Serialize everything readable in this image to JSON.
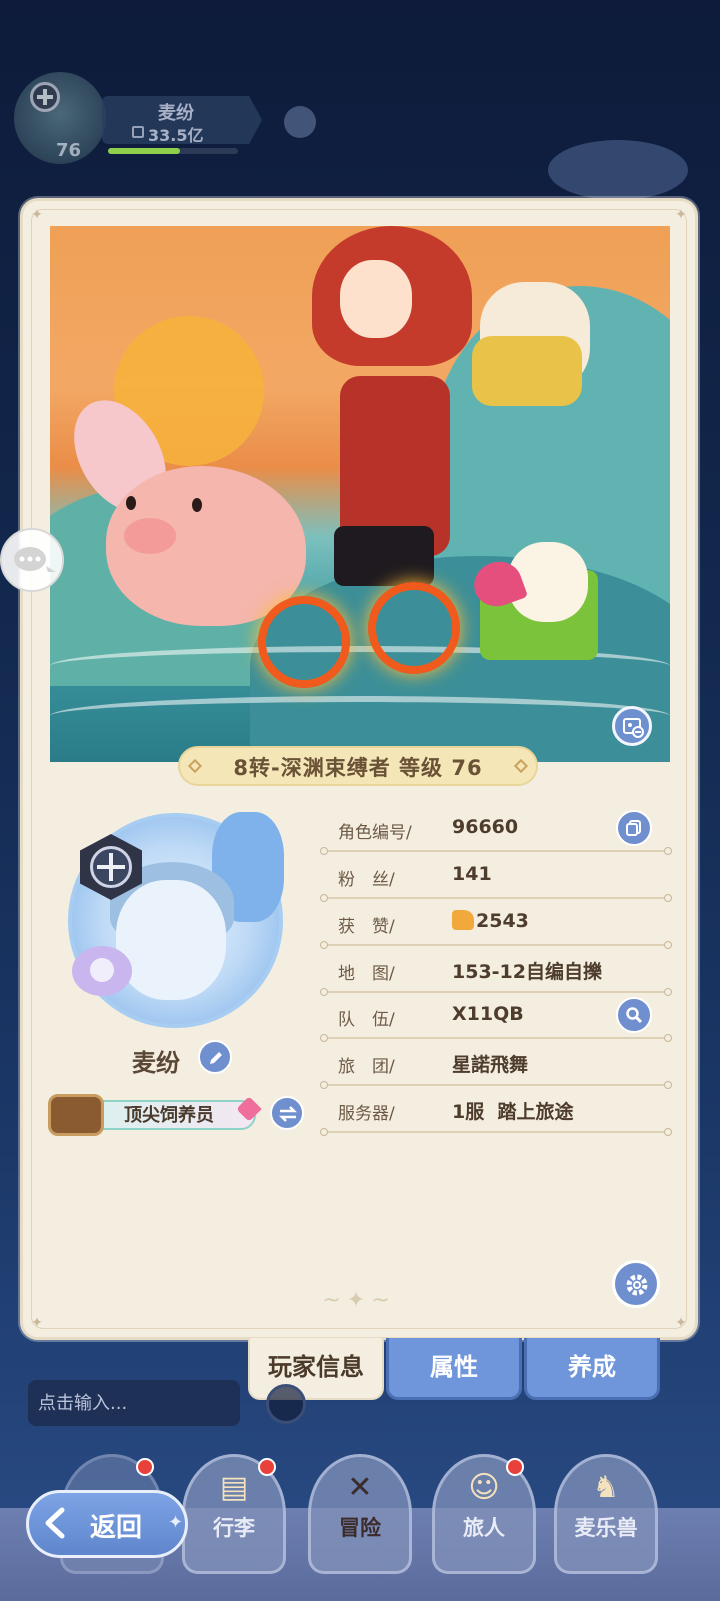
{
  "hud": {
    "player_name": "麦纷",
    "power": "33.5亿",
    "level": "76",
    "exp_fraction": 0.55
  },
  "showcase": {
    "class_title": "8转-深渊束缚者 等级 76"
  },
  "profile": {
    "name": "麦纷",
    "title": "顶尖饲养员"
  },
  "info": {
    "rows": [
      {
        "label": "角色编号/",
        "value": "96660"
      },
      {
        "label": "粉　丝/",
        "value": "141"
      },
      {
        "label": "获　赞/",
        "value": "2543"
      },
      {
        "label": "地　图/",
        "value": "153-12自编自擽"
      },
      {
        "label": "队　伍/",
        "value": "X11QB"
      },
      {
        "label": "旅　团/",
        "value": "星諾飛舞"
      },
      {
        "label": "服务器/",
        "value": "1服  踏上旅途"
      }
    ]
  },
  "tabs": {
    "player_info": "玩家信息",
    "attributes": "属性",
    "growth": "养成"
  },
  "chat": {
    "placeholder": "点击输入..."
  },
  "nav": {
    "back": "返回",
    "items": [
      {
        "label": "行李",
        "icon": "bag-icon"
      },
      {
        "label": "冒险",
        "icon": "crossed-swords-icon"
      },
      {
        "label": "旅人",
        "icon": "traveler-icon"
      },
      {
        "label": "麦乐兽",
        "icon": "pet-icon"
      }
    ]
  },
  "colors": {
    "accent_blue": "#6f8fce",
    "panel": "#f4eee1",
    "tab_inactive": "#6f95da"
  }
}
